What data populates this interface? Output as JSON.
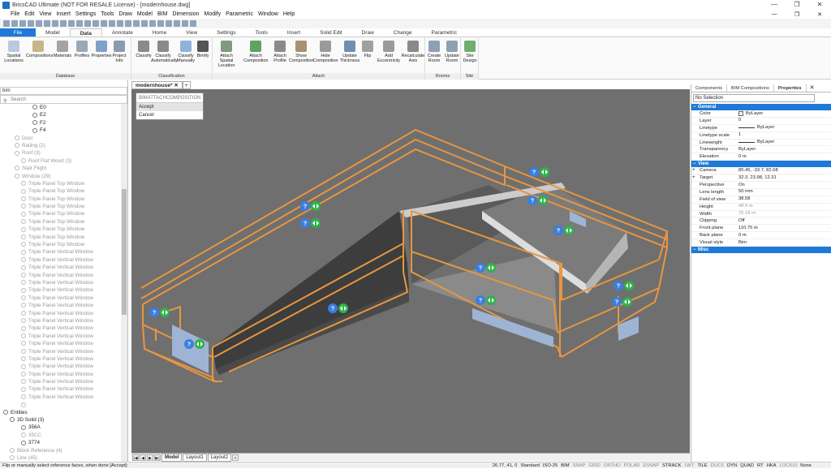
{
  "window": {
    "title": "BricsCAD Ultimate (NOT FOR RESALE License) - [modernhouse.dwg]",
    "min": "—",
    "restore": "❐",
    "close": "✕"
  },
  "menu": [
    "File",
    "Edit",
    "View",
    "Insert",
    "Settings",
    "Tools",
    "Draw",
    "Model",
    "BIM",
    "Dimension",
    "Modify",
    "Parametric",
    "Window",
    "Help"
  ],
  "tabs": [
    "File",
    "Model",
    "Data",
    "Annotate",
    "Home",
    "View",
    "Settings",
    "Tools",
    "Insert",
    "Solid Edit",
    "Draw",
    "Change",
    "Parametric"
  ],
  "active_tab": "Data",
  "ribbon": {
    "database": {
      "label": "Database",
      "buttons": [
        "Spatial Locations",
        "Compositions",
        "Materials",
        "Profiles",
        "Properties",
        "Project Info"
      ]
    },
    "classification": {
      "label": "Classification",
      "buttons": [
        "Classify",
        "Classify Automatically",
        "Classify Manually",
        "Bimify"
      ]
    },
    "attach": {
      "label": "Attach",
      "buttons": [
        "Attach Spatial Location",
        "Attach Composition",
        "Attach Profile",
        "Show Composition",
        "Hide Composition",
        "Update Thickness",
        "Flip",
        "Add Eccentricity",
        "Recalculate Axis"
      ]
    },
    "rooms": {
      "label": "Rooms",
      "buttons": [
        "Create Room",
        "Update Room"
      ]
    },
    "site": {
      "label": "Site",
      "buttons": [
        "Site Design"
      ]
    }
  },
  "left": {
    "top_input": "bim",
    "search_placeholder": "Search",
    "tree": [
      {
        "t": "E0",
        "d": false,
        "i": 40
      },
      {
        "t": "E2",
        "d": false,
        "i": 40
      },
      {
        "t": "F2",
        "d": false,
        "i": 40
      },
      {
        "t": "F4",
        "d": false,
        "i": 40
      },
      {
        "t": "Door",
        "d": true,
        "i": 18
      },
      {
        "t": "Railing (2)",
        "d": true,
        "i": 18
      },
      {
        "t": "Roof (3)",
        "d": true,
        "i": 18
      },
      {
        "t": "Roof Flat Wood (3)",
        "d": true,
        "i": 26
      },
      {
        "t": "Stair Flight",
        "d": true,
        "i": 18
      },
      {
        "t": "Window (29)",
        "d": true,
        "i": 18
      },
      {
        "t": "Triple Panel Top Window",
        "d": true,
        "i": 26
      },
      {
        "t": "Triple Panel Top Window",
        "d": true,
        "i": 26
      },
      {
        "t": "Triple Panel Top Window",
        "d": true,
        "i": 26
      },
      {
        "t": "Triple Panel Top Window",
        "d": true,
        "i": 26
      },
      {
        "t": "Triple Panel Top Window",
        "d": true,
        "i": 26
      },
      {
        "t": "Triple Panel Top Window",
        "d": true,
        "i": 26
      },
      {
        "t": "Triple Panel Top Window",
        "d": true,
        "i": 26
      },
      {
        "t": "Triple Panel Top Window",
        "d": true,
        "i": 26
      },
      {
        "t": "Triple Panel Top Window",
        "d": true,
        "i": 26
      },
      {
        "t": "Triple Panel Vertical Window",
        "d": true,
        "i": 26
      },
      {
        "t": "Triple Panel Vertical Window",
        "d": true,
        "i": 26
      },
      {
        "t": "Triple Panel Vertical Window",
        "d": true,
        "i": 26
      },
      {
        "t": "Triple Panel Vertical Window",
        "d": true,
        "i": 26
      },
      {
        "t": "Triple Panel Vertical Window",
        "d": true,
        "i": 26
      },
      {
        "t": "Triple Panel Vertical Window",
        "d": true,
        "i": 26
      },
      {
        "t": "Triple Panel Vertical Window",
        "d": true,
        "i": 26
      },
      {
        "t": "Triple Panel Vertical Window",
        "d": true,
        "i": 26
      },
      {
        "t": "Triple Panel Vertical Window",
        "d": true,
        "i": 26
      },
      {
        "t": "Triple Panel Vertical Window",
        "d": true,
        "i": 26
      },
      {
        "t": "Triple Panel Vertical Window",
        "d": true,
        "i": 26
      },
      {
        "t": "Triple Panel Vertical Window",
        "d": true,
        "i": 26
      },
      {
        "t": "Triple Panel Vertical Window",
        "d": true,
        "i": 26
      },
      {
        "t": "Triple Panel Vertical Window",
        "d": true,
        "i": 26
      },
      {
        "t": "Triple Panel Vertical Window",
        "d": true,
        "i": 26
      },
      {
        "t": "Triple Panel Vertical Window",
        "d": true,
        "i": 26
      },
      {
        "t": "Triple Panel Vertical Window",
        "d": true,
        "i": 26
      },
      {
        "t": "Triple Panel Vertical Window",
        "d": true,
        "i": 26
      },
      {
        "t": "Triple Panel Vertical Window",
        "d": true,
        "i": 26
      },
      {
        "t": "Triple Panel Vertical Window",
        "d": true,
        "i": 26
      },
      {
        "t": "",
        "d": true,
        "i": 26
      },
      {
        "t": "Entities",
        "d": false,
        "i": 4
      },
      {
        "t": "3D Solid (3)",
        "d": false,
        "i": 12
      },
      {
        "t": "356A",
        "d": false,
        "i": 26
      },
      {
        "t": "35CC",
        "d": true,
        "i": 26
      },
      {
        "t": "3774",
        "d": false,
        "i": 26
      },
      {
        "t": "Block Reference (4)",
        "d": true,
        "i": 12
      },
      {
        "t": "Line (45)",
        "d": true,
        "i": 12
      },
      {
        "t": "2E5E",
        "d": true,
        "i": 26
      }
    ]
  },
  "doc_tab": "modernhouse*",
  "context_menu": {
    "header": "BIMATTACHCOMPOSITION",
    "options": [
      "Accept",
      "Cancel"
    ]
  },
  "layout_tabs": [
    "Model",
    "Layout1",
    "Layout2"
  ],
  "right": {
    "tabs": [
      "Components",
      "BIM Compositions",
      "Properties"
    ],
    "active": "Properties",
    "selection": "No Selection",
    "general": {
      "title": "General",
      "rows": [
        [
          "Color",
          "ByLayer"
        ],
        [
          "Layer",
          "0"
        ],
        [
          "Linetype",
          "ByLayer"
        ],
        [
          "Linetype scale",
          "1"
        ],
        [
          "Lineweight",
          "ByLayer"
        ],
        [
          "Transparency",
          "ByLayer"
        ],
        [
          "Elevation",
          "0 m"
        ]
      ]
    },
    "view": {
      "title": "View",
      "rows": [
        [
          "Camera",
          "85.45, -33.7, 82.68"
        ],
        [
          "Target",
          "32.3, 23.98, 12.31"
        ],
        [
          "Perspective",
          "On"
        ],
        [
          "Lens length",
          "50 mm"
        ],
        [
          "Field of view",
          "38.58"
        ],
        [
          "Height",
          "48.9 m"
        ],
        [
          "Width",
          "75.18 m"
        ],
        [
          "Clipping",
          "Off"
        ],
        [
          "Front plane",
          "110.75 m"
        ],
        [
          "Back plane",
          "0 m"
        ],
        [
          "Visual style",
          "Bim"
        ]
      ]
    },
    "misc": {
      "title": "Misc"
    }
  },
  "status": {
    "command": "Flip or manually select reference faces, when done [Accept]:",
    "coords": "26.77, 41, 0",
    "items": [
      "Standard",
      "ISO-25",
      "BIM",
      "SNAP",
      "GRID",
      "ORTHO",
      "POLAR",
      "ESNAP",
      "STRACK",
      "LWT",
      "TILE",
      "DUCS",
      "DYN",
      "QUAD",
      "RT",
      "HKA",
      "LOCKUI",
      "None"
    ]
  },
  "colors": {
    "accent": "#1e7ad6",
    "frame": "#e9963f",
    "viewport": "#6f6f6f",
    "marker_blue": "#3a7fe0",
    "marker_green": "#2fb24a"
  }
}
